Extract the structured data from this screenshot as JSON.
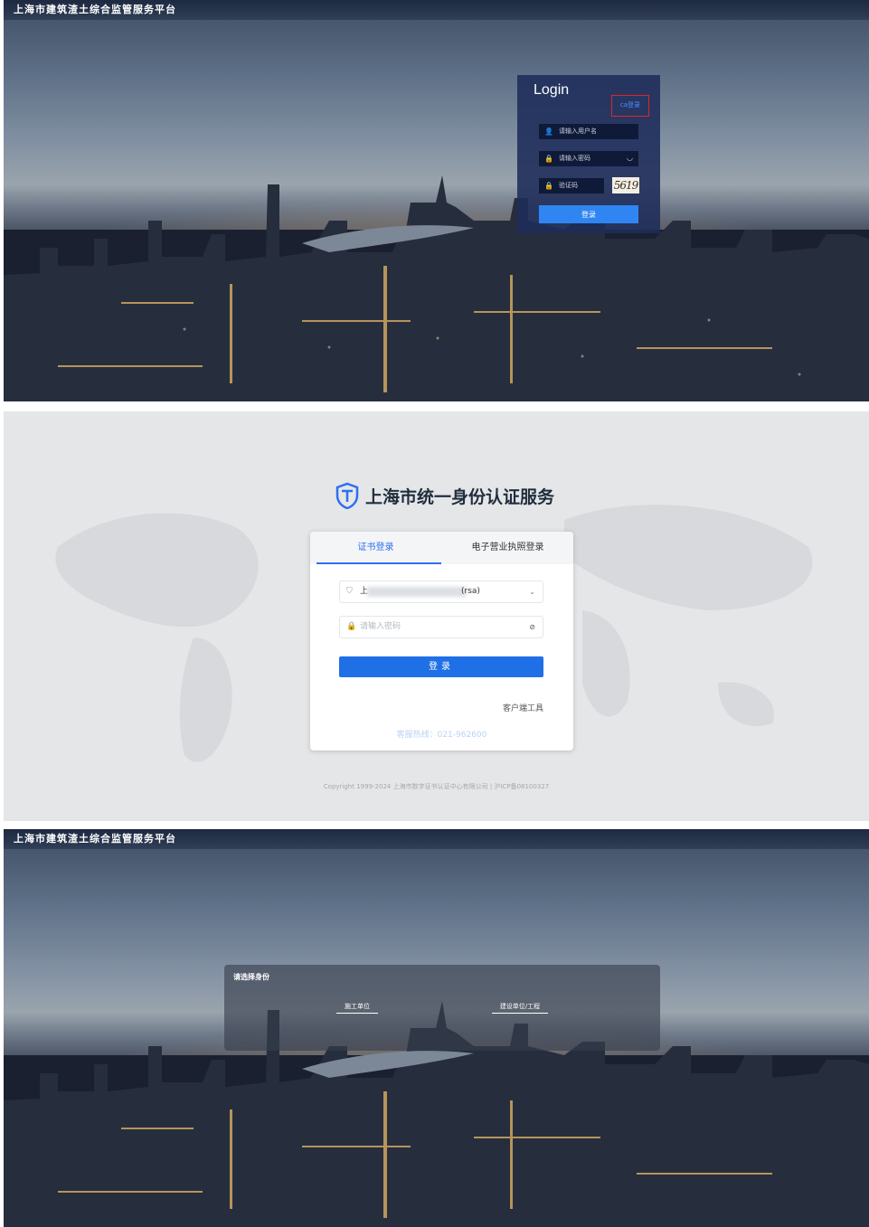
{
  "panel1": {
    "platform_title": "上海市建筑渣土综合监管服务平台",
    "login_title": "Login",
    "ca_login": "ca登录",
    "username_placeholder": "请输入用户名",
    "password_placeholder": "请输入密码",
    "captcha_placeholder": "验证码",
    "captcha_text": "5619",
    "login_button": "登录"
  },
  "panel2": {
    "brand": "上海市统一身份认证服务",
    "tabs": [
      "证书登录",
      "电子营业执照登录"
    ],
    "cert_select_prefix": "上",
    "cert_select_suffix": "(rsa)",
    "password_placeholder": "请输入密码",
    "login_button": "登录",
    "client_tool": "客户端工具",
    "hotline": "客服热线：021-962600",
    "copyright": "Copyright 1999-2024 上海市数字证书认证中心有限公司 | 沪ICP备08100327"
  },
  "panel3": {
    "platform_title": "上海市建筑渣土综合监管服务平台",
    "role_prompt": "请选择身份",
    "roles": [
      "施工单位",
      "建设单位/工程"
    ]
  },
  "colors": {
    "accent_blue": "#2f86f2",
    "cert_blue": "#1f6fe6",
    "highlight_red": "#e0242a"
  }
}
